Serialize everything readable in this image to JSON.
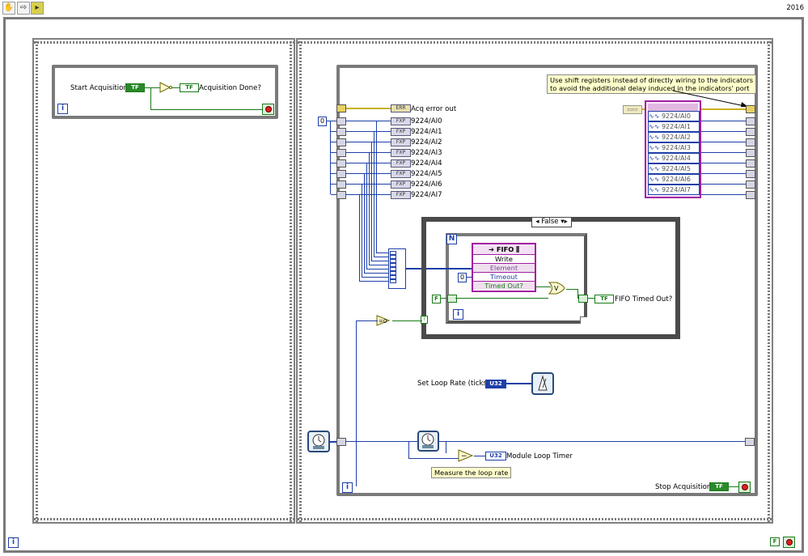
{
  "toolbar": {
    "year": "2016",
    "buttons": [
      "hand-tool",
      "arrow-forward",
      "run-highlight"
    ]
  },
  "left_frame": {
    "start_label": "Start Acquisition",
    "start_term": "TF",
    "done_label": "Acquisition Done?",
    "done_term": "TF",
    "iter": "i"
  },
  "main_loop": {
    "acq_error_label": "Acq error out",
    "const_zero": "0",
    "channels": [
      "9224/AI0",
      "9224/AI1",
      "9224/AI2",
      "9224/AI3",
      "9224/AI4",
      "9224/AI5",
      "9224/AI6",
      "9224/AI7"
    ],
    "fxp_term": "FXP",
    "err_term": "ERR",
    "note": [
      "Use shift registers instead of directly wiring to the indicators",
      "to avoid the additional delay induced in the indicators' port"
    ],
    "bundle_rows": [
      "9224/AI0",
      "9224/AI1",
      "9224/AI2",
      "9224/AI3",
      "9224/AI4",
      "9224/AI5",
      "9224/AI6",
      "9224/AI7"
    ],
    "case_selector": "False",
    "for_n": "N",
    "fifo": {
      "title": "FIFO",
      "method": "Write",
      "element": "Element",
      "timeout": "Timeout",
      "timed_out": "Timed Out?"
    },
    "timeout_const": "0",
    "false_const": "F",
    "fifo_timed_out_label": "FIFO Timed Out?",
    "fifo_timed_out_term": "TF",
    "loop_rate_label": "Set Loop Rate (ticks)",
    "loop_rate_term": "U32",
    "module_timer_label": "Module Loop Timer",
    "module_timer_term": "U32",
    "measure_note": "Measure the loop rate",
    "stop_label": "Stop Acquisition",
    "stop_term": "TF",
    "iter": "i",
    "inner_iter": "i"
  },
  "outer_loop": {
    "iter": "i",
    "false_const": "F"
  }
}
